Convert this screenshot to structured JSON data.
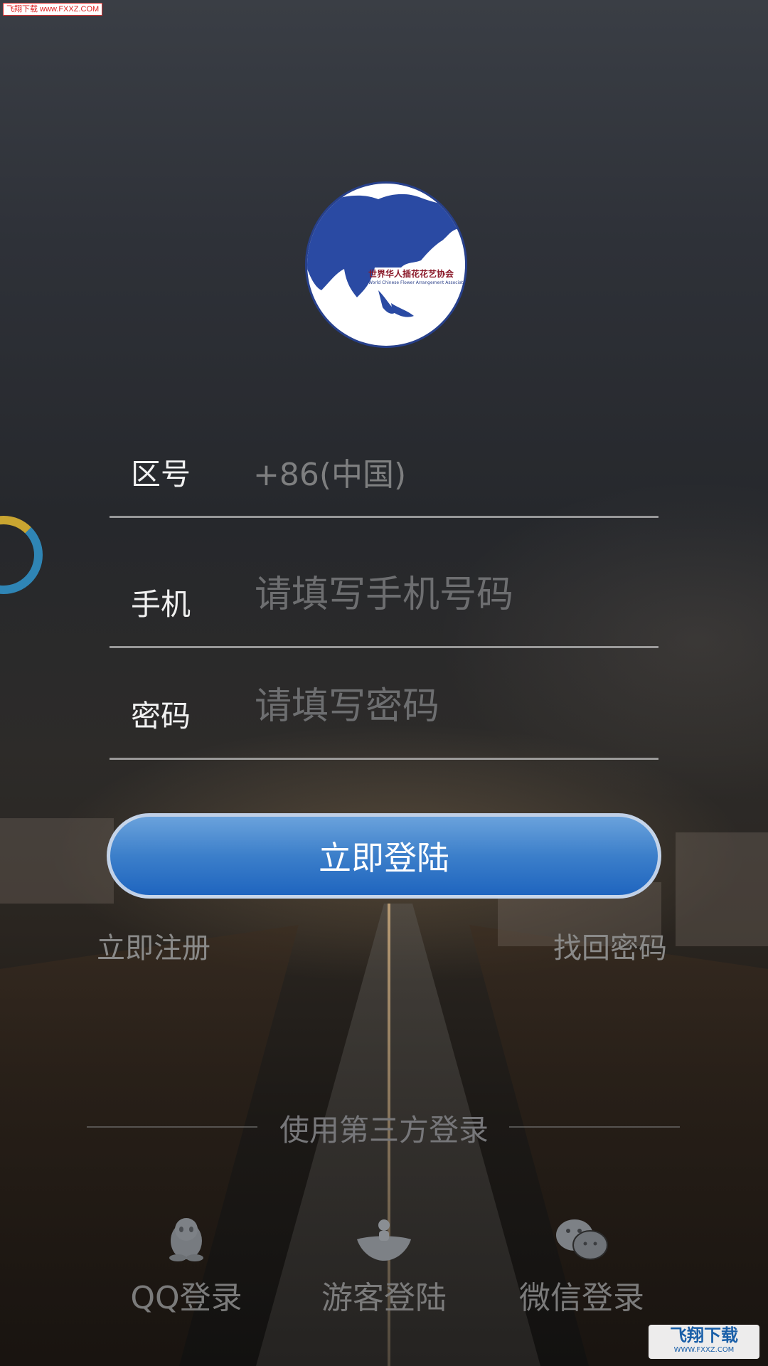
{
  "watermark_top": "飞翔下载 www.FXXZ.COM",
  "logo": {
    "title": "世界华人插花花艺协会",
    "subtitle": "World Chinese Flower Arrangement Association"
  },
  "form": {
    "region": {
      "label": "区号",
      "value": "+86(中国)"
    },
    "phone": {
      "label": "手机",
      "placeholder": "请填写手机号码"
    },
    "password": {
      "label": "密码",
      "placeholder": "请填写密码"
    },
    "login_button": "立即登陆"
  },
  "links": {
    "register": "立即注册",
    "forgot": "找回密码"
  },
  "third_party": {
    "title": "使用第三方登录",
    "options": [
      {
        "label": "QQ登录",
        "icon": "qq-penguin-icon"
      },
      {
        "label": "游客登陆",
        "icon": "guest-icon"
      },
      {
        "label": "微信登录",
        "icon": "wechat-icon"
      }
    ]
  },
  "watermark_bottom": {
    "title": "飞翔下载",
    "url": "WWW.FXXZ.COM"
  }
}
